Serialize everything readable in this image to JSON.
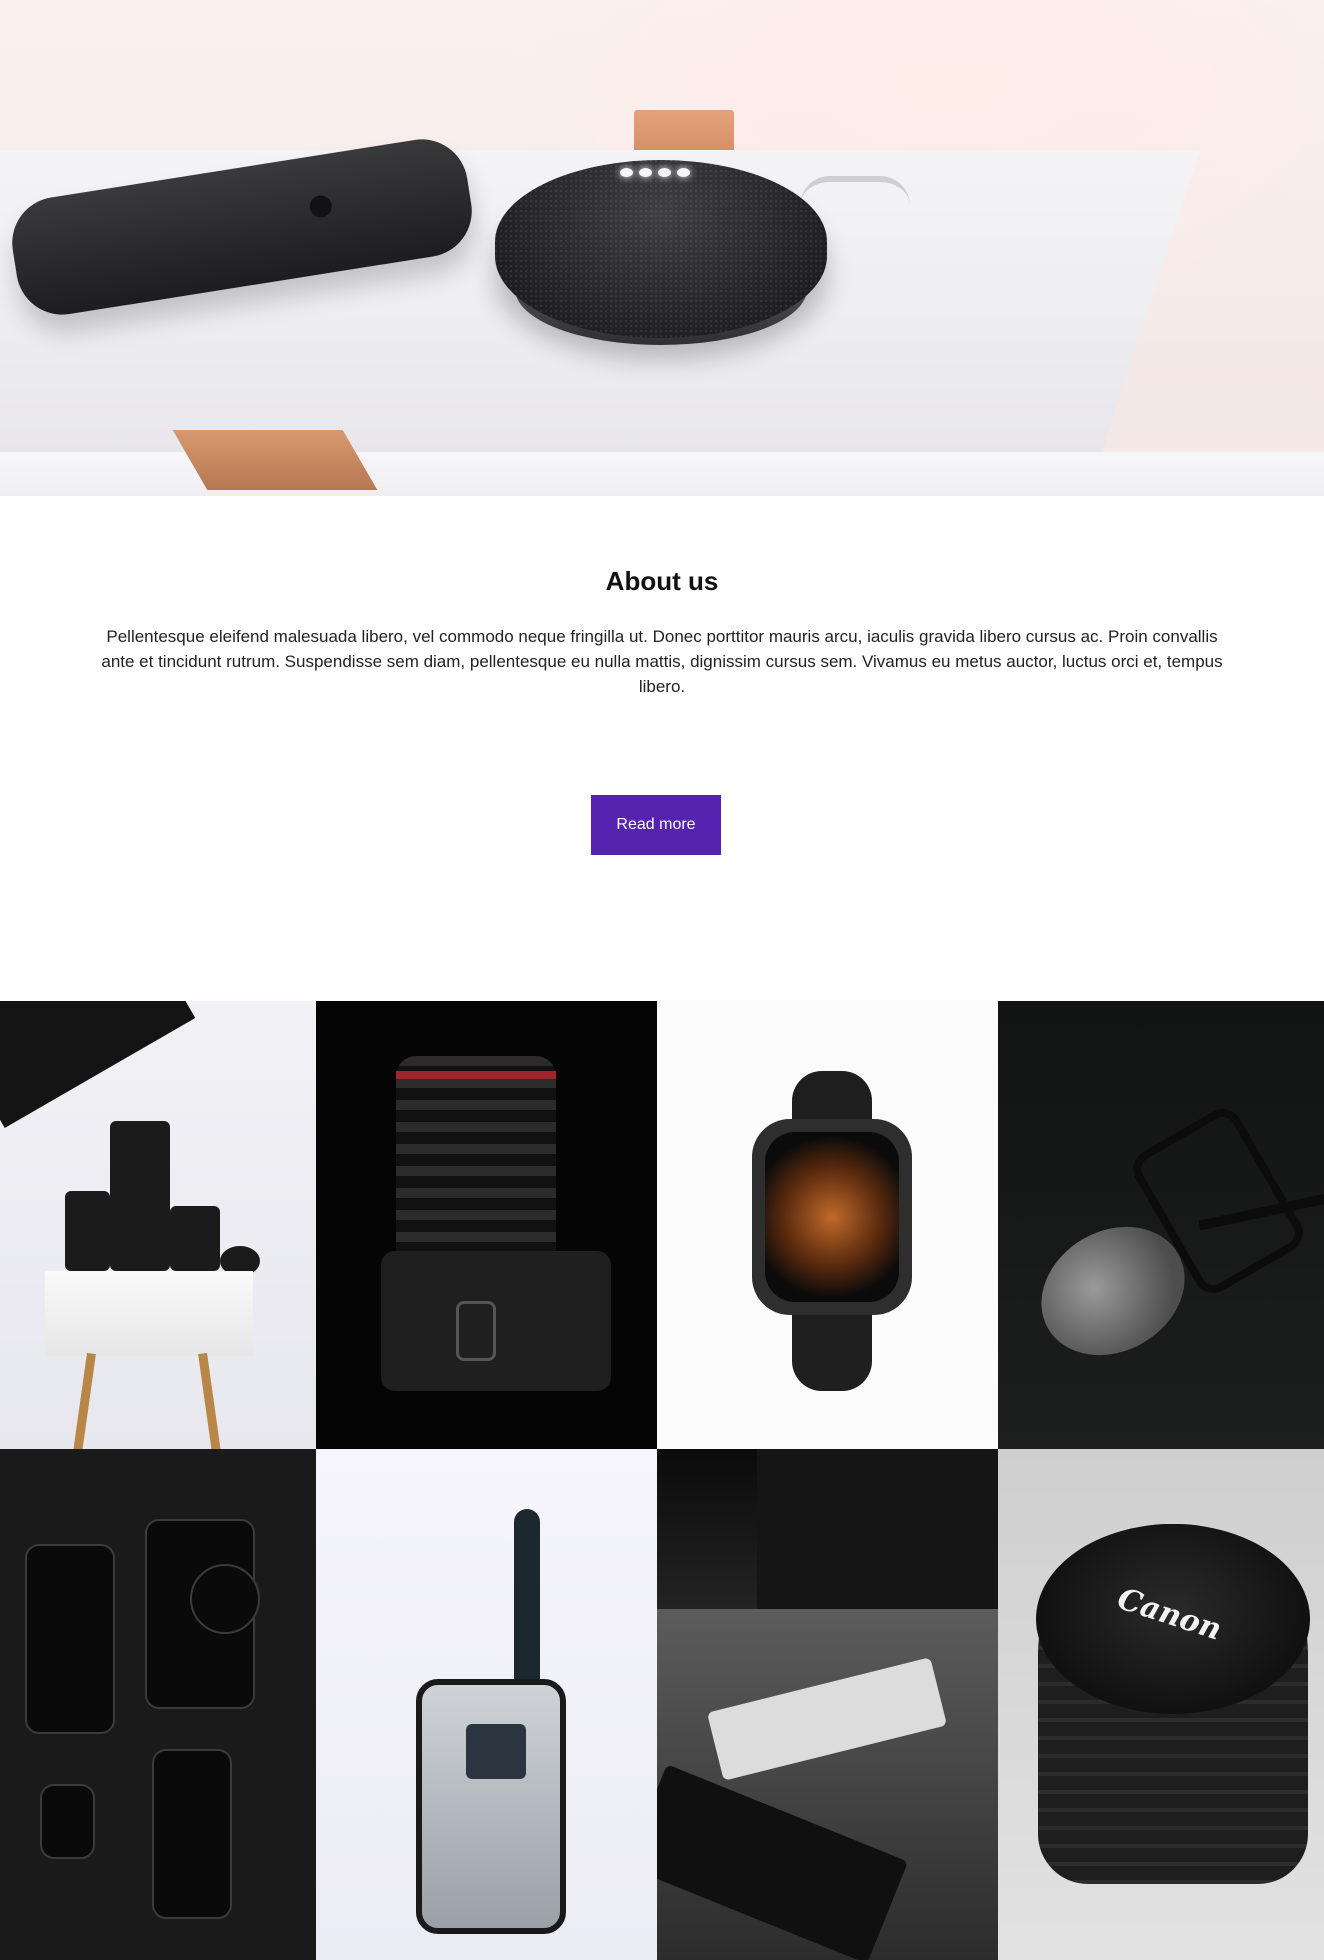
{
  "hero": {
    "alt": "Phone and smart speaker on a white shelf"
  },
  "about": {
    "title": "About us",
    "body": "Pellentesque eleifend malesuada libero, vel commodo neque fringilla ut. Donec porttitor mauris arcu, iaculis gravida libero cursus ac. Proin convallis ante et tincidunt rutrum. Suspendisse sem diam, pellentesque eu nulla mattis, dignissim cursus sem. Vivamus eu metus auctor, luctus orci et, tempus libero.",
    "button_label": "Read more",
    "button_color": "#5523b0"
  },
  "gallery": {
    "lens_brand": "Canon"
  }
}
